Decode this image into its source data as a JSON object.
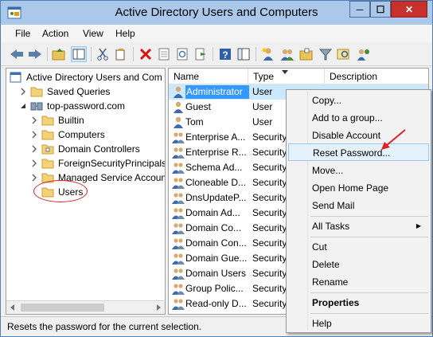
{
  "window": {
    "title": "Active Directory Users and Computers",
    "min_glyph": "─",
    "max_glyph": "☐",
    "close_glyph": "✕"
  },
  "menu": [
    "File",
    "Action",
    "View",
    "Help"
  ],
  "toolbar": {
    "icons": [
      "back-icon",
      "forward-icon",
      "up-folder-icon",
      "show-tree-icon",
      "cut-icon",
      "copy-icon",
      "delete-icon",
      "properties-icon",
      "refresh-icon",
      "export-icon",
      "help-icon",
      "console-icon",
      "new-user-icon",
      "new-group-icon",
      "new-ou-icon",
      "filter-icon",
      "find-icon",
      "add-to-group-icon"
    ]
  },
  "tree": {
    "root": "Active Directory Users and Com",
    "items": [
      {
        "label": "Saved Queries",
        "level": 1,
        "expand": "collapsed"
      },
      {
        "label": "top-password.com",
        "level": 1,
        "expand": "expanded"
      },
      {
        "label": "Builtin",
        "level": 2,
        "expand": "collapsed"
      },
      {
        "label": "Computers",
        "level": 2,
        "expand": "collapsed"
      },
      {
        "label": "Domain Controllers",
        "level": 2,
        "expand": "collapsed"
      },
      {
        "label": "ForeignSecurityPrincipals",
        "level": 2,
        "expand": "collapsed"
      },
      {
        "label": "Managed Service Accoun",
        "level": 2,
        "expand": "collapsed"
      },
      {
        "label": "Users",
        "level": 2,
        "expand": "none",
        "selected": true
      }
    ]
  },
  "list": {
    "columns": [
      "Name",
      "Type",
      "Description"
    ],
    "rows": [
      {
        "name": "Administrator",
        "type": "User",
        "kind": "user",
        "selected": true
      },
      {
        "name": "Guest",
        "type": "User",
        "kind": "user"
      },
      {
        "name": "Tom",
        "type": "User",
        "kind": "user"
      },
      {
        "name": "Enterprise A...",
        "type": "Security",
        "kind": "group"
      },
      {
        "name": "Enterprise R...",
        "type": "Security",
        "kind": "group"
      },
      {
        "name": "Schema Ad...",
        "type": "Security",
        "kind": "group"
      },
      {
        "name": "Cloneable D...",
        "type": "Security",
        "kind": "group"
      },
      {
        "name": "DnsUpdateP...",
        "type": "Security",
        "kind": "group"
      },
      {
        "name": "Domain Ad...",
        "type": "Security",
        "kind": "group"
      },
      {
        "name": "Domain Co...",
        "type": "Security",
        "kind": "group"
      },
      {
        "name": "Domain Con...",
        "type": "Security",
        "kind": "group"
      },
      {
        "name": "Domain Gue...",
        "type": "Security",
        "kind": "group"
      },
      {
        "name": "Domain Users",
        "type": "Security",
        "kind": "group"
      },
      {
        "name": "Group Polic...",
        "type": "Security",
        "kind": "group"
      },
      {
        "name": "Read-only D...",
        "type": "Security",
        "kind": "group"
      }
    ]
  },
  "context_menu": {
    "items": [
      {
        "label": "Copy..."
      },
      {
        "label": "Add to a group..."
      },
      {
        "label": "Disable Account"
      },
      {
        "label": "Reset Password...",
        "highlighted": true
      },
      {
        "label": "Move..."
      },
      {
        "label": "Open Home Page"
      },
      {
        "label": "Send Mail"
      },
      {
        "label": "All Tasks",
        "submenu": true,
        "submenu_glyph": "▶"
      },
      {
        "label": "Cut"
      },
      {
        "label": "Delete"
      },
      {
        "label": "Rename"
      },
      {
        "label": "Properties",
        "bold": true
      },
      {
        "label": "Help"
      }
    ]
  },
  "status": "Resets the password for the current selection.",
  "colors": {
    "selection": "#3399ff",
    "annotation": "#dd2222",
    "titlebar": "#a9c8ea",
    "close": "#c7312b"
  }
}
